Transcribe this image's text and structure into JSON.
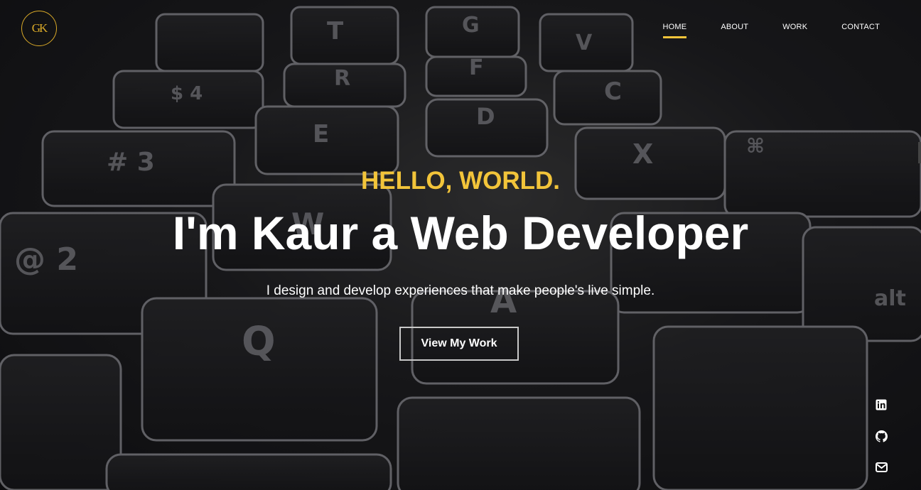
{
  "brand": {
    "logo_text": "GK",
    "accent": "#f2c43a"
  },
  "nav": {
    "items": [
      {
        "label": "HOME",
        "active": true
      },
      {
        "label": "ABOUT",
        "active": false
      },
      {
        "label": "WORK",
        "active": false
      },
      {
        "label": "CONTACT",
        "active": false
      }
    ]
  },
  "hero": {
    "greeting": "HELLO, WORLD.",
    "headline": "I'm Kaur a Web Developer",
    "subtitle": "I design and develop experiences that make people's live simple.",
    "cta_label": "View My Work"
  },
  "social": {
    "icons": [
      "linkedin-icon",
      "github-icon",
      "mail-icon"
    ]
  }
}
